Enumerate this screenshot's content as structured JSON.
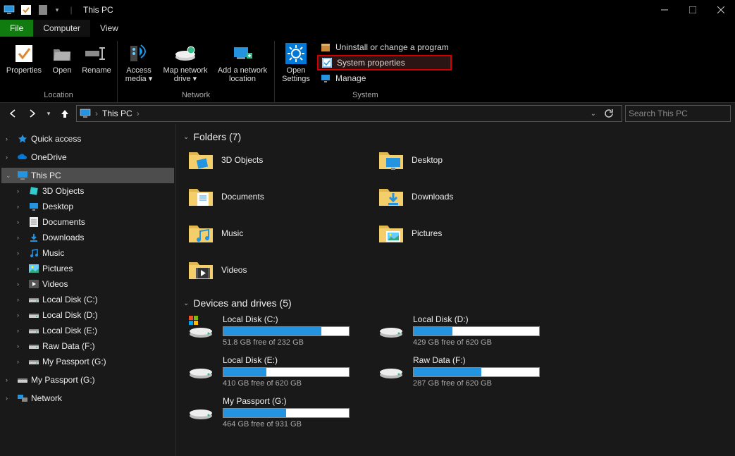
{
  "window": {
    "title": "This PC"
  },
  "tabs": {
    "file": "File",
    "computer": "Computer",
    "view": "View"
  },
  "ribbon": {
    "location": {
      "label": "Location",
      "properties": "Properties",
      "open": "Open",
      "rename": "Rename"
    },
    "network": {
      "label": "Network",
      "access_media": "Access media",
      "map_drive": "Map network drive",
      "add_loc": "Add a network location"
    },
    "system": {
      "label": "System",
      "open_settings": "Open Settings",
      "uninstall": "Uninstall or change a program",
      "sysprops": "System properties",
      "manage": "Manage"
    }
  },
  "address": {
    "root": "This PC"
  },
  "search": {
    "placeholder": "Search This PC"
  },
  "tree": {
    "quickaccess": "Quick access",
    "onedrive": "OneDrive",
    "thispc": "This PC",
    "network": "Network",
    "children": [
      {
        "label": "3D Objects"
      },
      {
        "label": "Desktop"
      },
      {
        "label": "Documents"
      },
      {
        "label": "Downloads"
      },
      {
        "label": "Music"
      },
      {
        "label": "Pictures"
      },
      {
        "label": "Videos"
      },
      {
        "label": "Local Disk (C:)"
      },
      {
        "label": "Local Disk (D:)"
      },
      {
        "label": "Local Disk (E:)"
      },
      {
        "label": "Raw Data (F:)"
      },
      {
        "label": "My Passport (G:)"
      }
    ],
    "extra": {
      "label": "My Passport (G:)"
    }
  },
  "folders": {
    "heading": "Folders",
    "count": 7,
    "items": [
      {
        "label": "3D Objects"
      },
      {
        "label": "Desktop"
      },
      {
        "label": "Documents"
      },
      {
        "label": "Downloads"
      },
      {
        "label": "Music"
      },
      {
        "label": "Pictures"
      },
      {
        "label": "Videos"
      }
    ]
  },
  "drives": {
    "heading": "Devices and drives",
    "count": 5,
    "items": [
      {
        "label": "Local Disk (C:)",
        "free_text": "51.8 GB free of 232 GB",
        "pct_used": 78
      },
      {
        "label": "Local Disk (D:)",
        "free_text": "429 GB free of 620 GB",
        "pct_used": 31
      },
      {
        "label": "Local Disk (E:)",
        "free_text": "410 GB free of 620 GB",
        "pct_used": 34
      },
      {
        "label": "Raw Data (F:)",
        "free_text": "287 GB free of 620 GB",
        "pct_used": 54
      },
      {
        "label": "My Passport (G:)",
        "free_text": "464 GB free of 931 GB",
        "pct_used": 50
      }
    ]
  }
}
